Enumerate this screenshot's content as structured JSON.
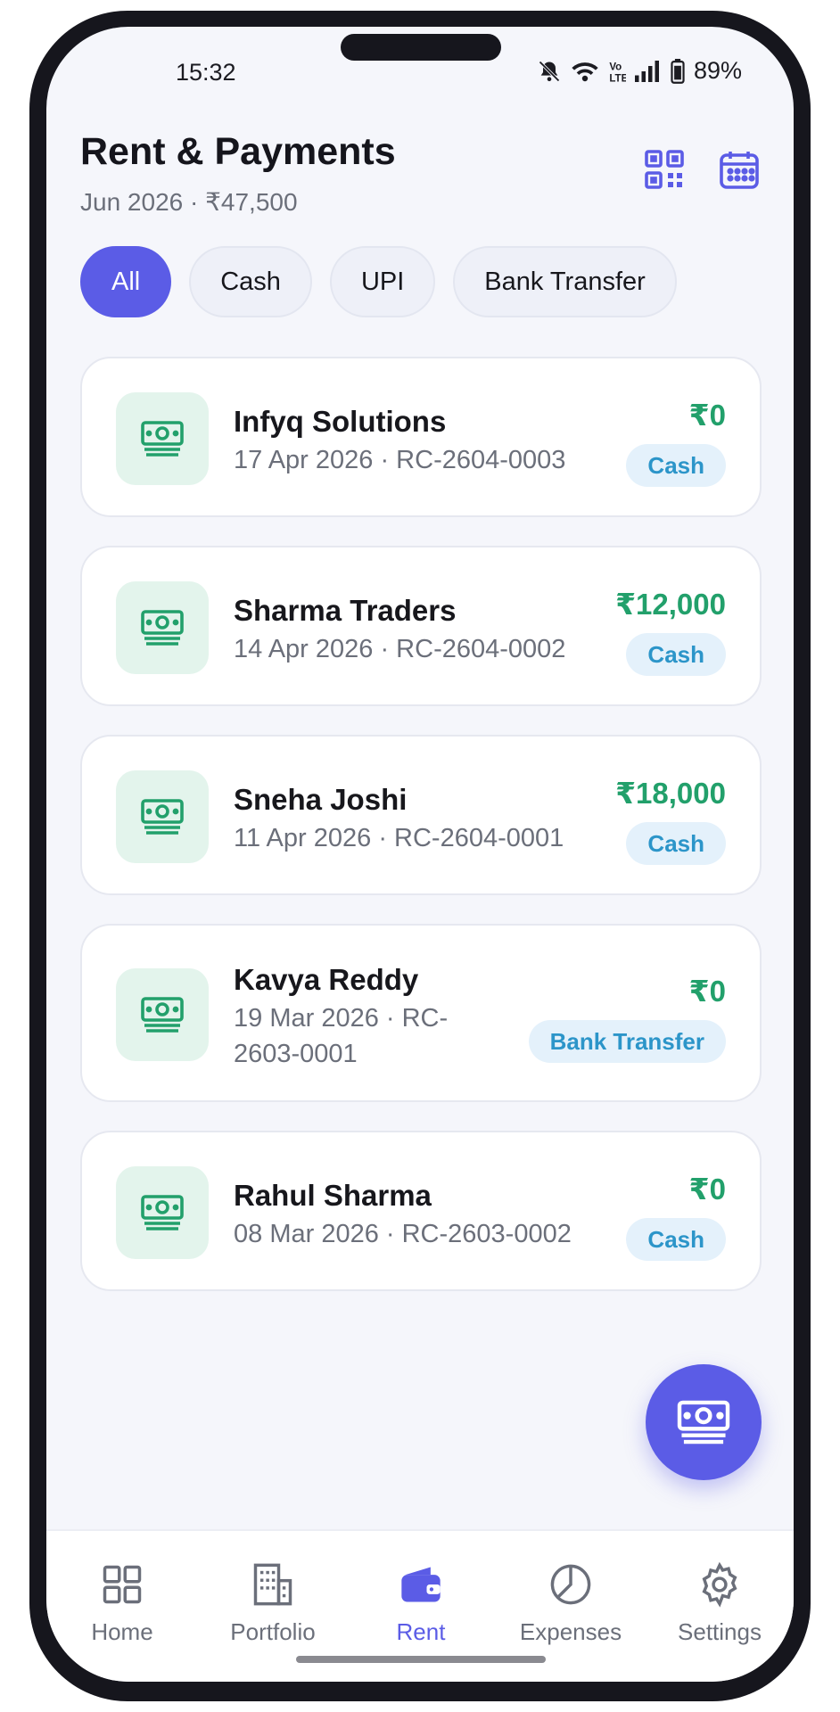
{
  "status_bar": {
    "time": "15:32",
    "battery": "89%"
  },
  "header": {
    "title": "Rent & Payments",
    "subtitle": "Jun 2026 · ₹47,500"
  },
  "filters": [
    {
      "label": "All",
      "active": true
    },
    {
      "label": "Cash",
      "active": false
    },
    {
      "label": "UPI",
      "active": false
    },
    {
      "label": "Bank Transfer",
      "active": false
    }
  ],
  "payments": [
    {
      "name": "Infyq Solutions",
      "meta": "17 Apr 2026 · RC-2604-0003",
      "amount": "₹0",
      "method": "Cash"
    },
    {
      "name": "Sharma Traders",
      "meta": "14 Apr 2026 · RC-2604-0002",
      "amount": "₹12,000",
      "method": "Cash"
    },
    {
      "name": "Sneha Joshi",
      "meta": "11 Apr 2026 · RC-2604-0001",
      "amount": "₹18,000",
      "method": "Cash"
    },
    {
      "name": "Kavya Reddy",
      "meta": "19 Mar 2026 · RC-2603-0001",
      "amount": "₹0",
      "method": "Bank Transfer"
    },
    {
      "name": "Rahul Sharma",
      "meta": "08 Mar 2026 · RC-2603-0002",
      "amount": "₹0",
      "method": "Cash"
    }
  ],
  "nav": [
    {
      "label": "Home",
      "icon": "grid-icon"
    },
    {
      "label": "Portfolio",
      "icon": "building-icon"
    },
    {
      "label": "Rent",
      "icon": "wallet-icon",
      "active": true
    },
    {
      "label": "Expenses",
      "icon": "pie-chart-icon"
    },
    {
      "label": "Settings",
      "icon": "gear-icon"
    }
  ],
  "colors": {
    "accent": "#5b5ce6",
    "amount": "#22a06b",
    "badge_text": "#2c95c9",
    "badge_bg": "#e4f1fb",
    "icon_bg": "#e3f4ec"
  }
}
